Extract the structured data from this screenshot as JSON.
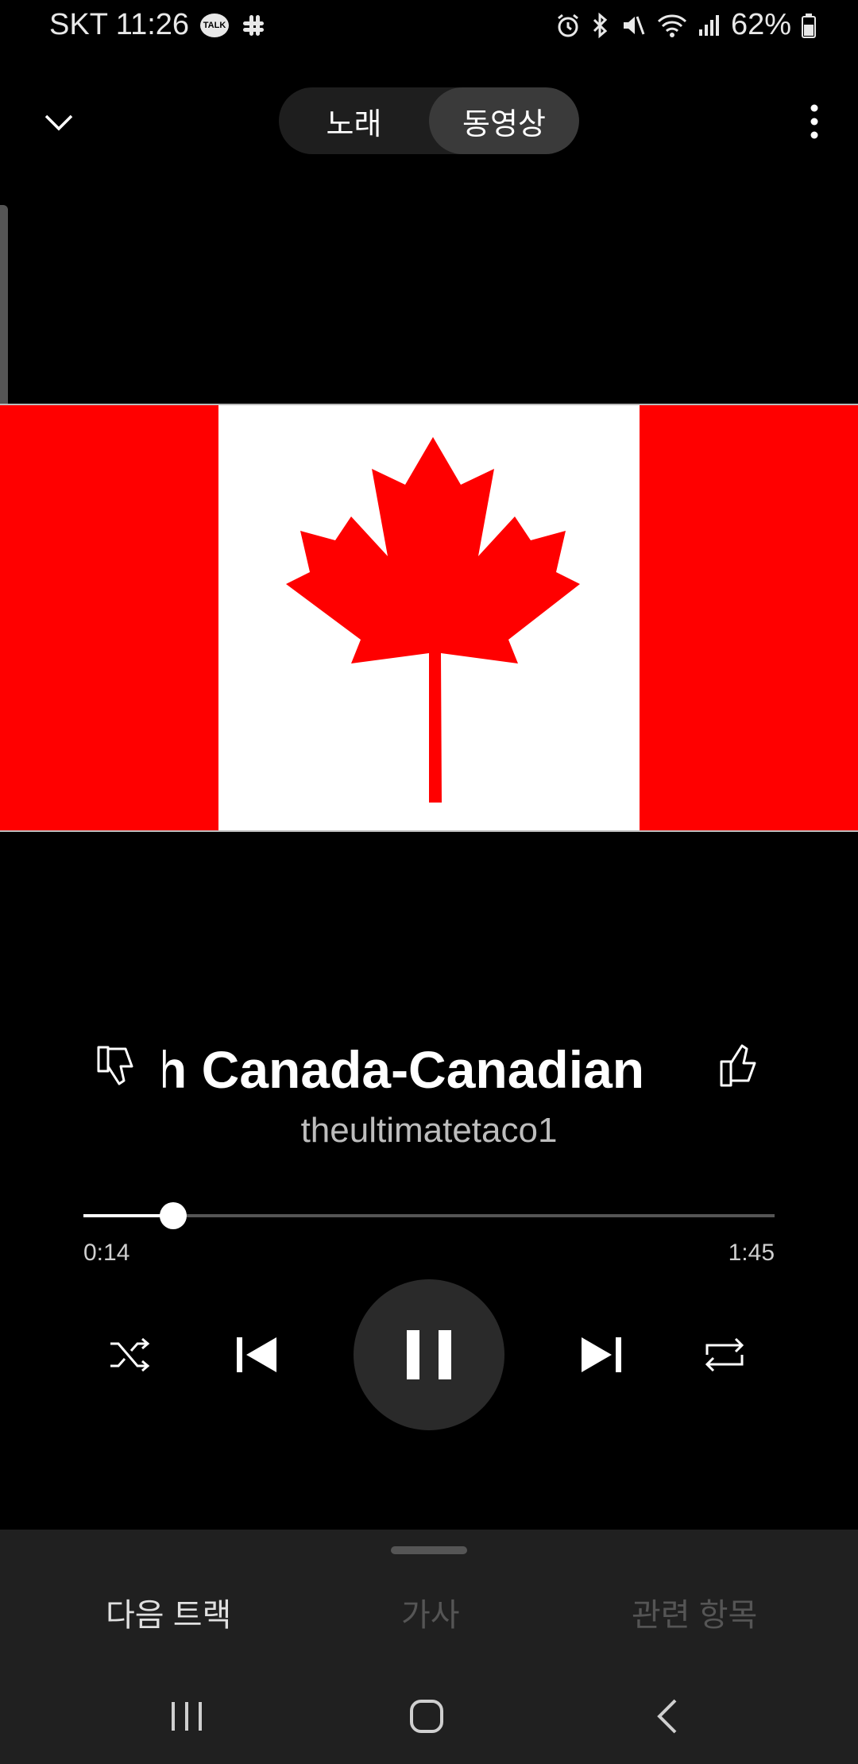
{
  "status_bar": {
    "carrier_time": "SKT 11:26",
    "battery": "62%",
    "talk_badge": "TALK"
  },
  "header": {
    "tabs": [
      "노래",
      "동영상"
    ],
    "active_tab": "동영상"
  },
  "track": {
    "title": "h Canada-Canadian",
    "artist": "theultimatetaco1",
    "elapsed": "0:14",
    "duration": "1:45",
    "progress_fraction": 0.13
  },
  "bottom_tabs": [
    "다음 트랙",
    "가사",
    "관련 항목"
  ],
  "colors": {
    "flag_red": "#ff0000",
    "background": "#000000",
    "panel": "#202020"
  }
}
